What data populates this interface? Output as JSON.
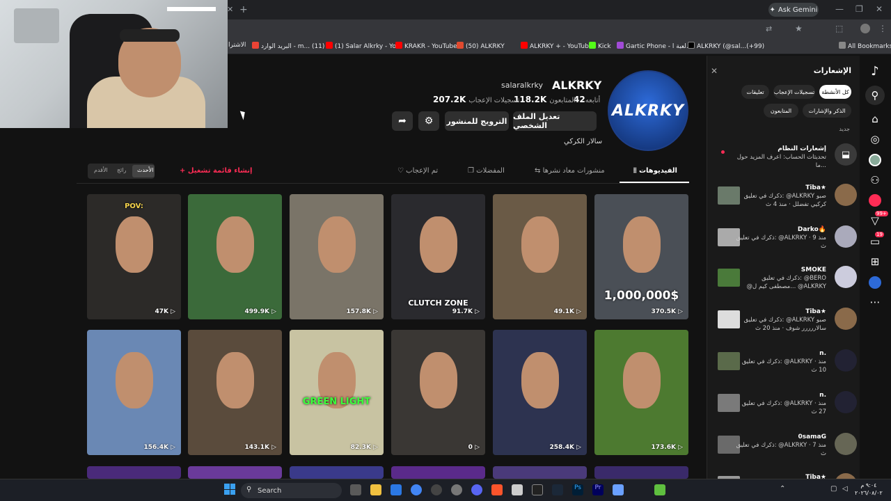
{
  "browser": {
    "gemini_label": "Ask Gemini",
    "bookmarks": [
      {
        "label": "الاشترا",
        "color": "#888"
      },
      {
        "label": "البريد الوارد - m... (11)",
        "color": "#ea4335"
      },
      {
        "label": "(1) Salar Alkrky - Yo...",
        "color": "#ff0000"
      },
      {
        "label": "KRAKR - YouTube",
        "color": "#ff0000"
      },
      {
        "label": "(50) ALKRKY",
        "color": "#e04a2f"
      },
      {
        "label": "ALKRKY + - YouTube",
        "color": "#ff0000"
      },
      {
        "label": "Kick",
        "color": "#53fc18"
      },
      {
        "label": "Gartic Phone - لعبة ا...",
        "color": "#a14bd6"
      },
      {
        "label": "ALKRKY (@sal...(+99)",
        "color": "#000"
      },
      {
        "label": "All Bookmarks",
        "color": "#888"
      }
    ]
  },
  "profile": {
    "username": "ALKRKY",
    "handle": "salaralkrky",
    "bio": "سالار الكركي",
    "stats": [
      {
        "label": "أتابعه",
        "value": "42"
      },
      {
        "label": "المتابعون",
        "value": "118.2K"
      },
      {
        "label": "تسجيلات الإعجاب",
        "value": "207.2K"
      }
    ],
    "edit_button": "تعديل الملف الشخصي",
    "promote_button": "الترويج للمنشور",
    "avatar_text": "ALKRKY"
  },
  "tabs": {
    "videos": "الفيديوهات",
    "reposts": "منشورات معاد نشرها",
    "favorites": "المفضلات",
    "liked": "تم الإعجاب",
    "create_playlist": "+ إنشاء قائمة تشغيل",
    "sort": [
      "الأحدث",
      "رائج",
      "الأقدم"
    ]
  },
  "videos": [
    {
      "views": "370.5K",
      "caption": "1,000,000$",
      "bg": "#4a4f56"
    },
    {
      "views": "49.1K",
      "caption": "",
      "bg": "#6a5a46"
    },
    {
      "views": "91.7K",
      "caption": "CLUTCH ZONE",
      "bg": "#2a2a2e"
    },
    {
      "views": "157.8K",
      "caption": "",
      "bg": "#7a7468"
    },
    {
      "views": "499.9K",
      "caption": "",
      "bg": "#3b6a3a"
    },
    {
      "views": "47K",
      "caption": "POV:",
      "bg": "#2c2a28"
    },
    {
      "views": "173.6K",
      "caption": "",
      "bg": "#4d7a30"
    },
    {
      "views": "258.4K",
      "caption": "",
      "bg": "#2d3350"
    },
    {
      "views": "0",
      "caption": "",
      "bg": "#3a3734"
    },
    {
      "views": "82.3K",
      "caption": "GREEN LIGHT",
      "bg": "#c8c3a2"
    },
    {
      "views": "143.1K",
      "caption": "",
      "bg": "#5a4b3c"
    },
    {
      "views": "156.4K",
      "caption": "",
      "bg": "#6a88b4"
    }
  ],
  "notifications": {
    "title": "الإشعارات",
    "chips": [
      "كل الأنشطة",
      "تسجيلات الإعجاب",
      "تعليقات",
      "الذكر والإشارات",
      "المتابعون"
    ],
    "new_label": "جديد",
    "system": {
      "title": "إشعارات النظام",
      "body": "تحديثات الحساب: اعرف المزيد حول ما..."
    },
    "items": [
      {
        "name": "Tiba★",
        "text": "ذكرك في تعليق: @ALKRKY صبو كركيي تفضلل · منذ 4 ث"
      },
      {
        "name": "Darko🔥",
        "text": "ذكرك في تعليق: @ALKRKY · منذ 9 ث"
      },
      {
        "name": "SMOKE",
        "text": "ذكرك في تعليق: @BERO @مصطفى كيم ل... @ALKRKY"
      },
      {
        "name": "Tiba★",
        "text": "ذكرك في تعليق: @ALKRKY صبو سالاررررر شوف · منذ 20 ث"
      },
      {
        "name": "n.",
        "text": "ذكرك في تعليق: @ALKRKY · منذ 10 ث"
      },
      {
        "name": "n.",
        "text": "ذكرك في تعليق: @ALKRKY · منذ 27 ث"
      },
      {
        "name": "0samaG",
        "text": "ذكرك في تعليق: @ALKRKY · منذ 7 ث"
      },
      {
        "name": "Tiba★",
        "text": "ذكرك في تعليق: @ALKRKY"
      }
    ]
  },
  "taskbar": {
    "search": "Search",
    "time": "٩:٠٤ م",
    "date": "٢٠٢٦/٠٨/٠٢"
  },
  "rail_badges": {
    "inbox": "99+",
    "messages": "19"
  }
}
